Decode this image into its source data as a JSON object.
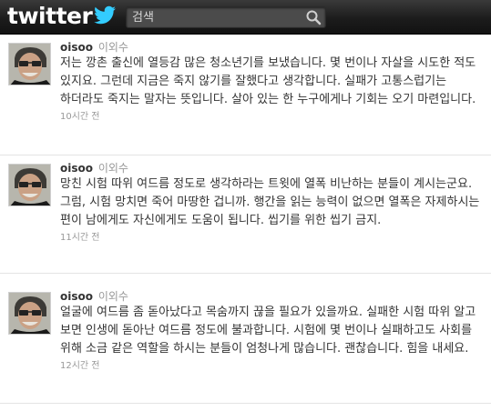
{
  "header": {
    "logo_text": "twitter",
    "search_placeholder": "검색",
    "search_icon": "magnifier-icon",
    "colors": {
      "bar": "#1c1c1c",
      "bird": "#33ccff"
    }
  },
  "tweets": [
    {
      "screen_name": "oisoo",
      "full_name": "이외수",
      "text": "저는 깡촌 출신에 열등감 많은 청소년기를 보냈습니다. 몇 번이나 자살을 시도한 적도 있지요. 그런데 지금은 죽지 않기를 잘했다고 생각합니다. 실패가 고통스럽기는 하더라도 죽지는 말자는 뜻입니다. 살아 있는 한 누구에게나 기회는 오기 마련입니다.",
      "time": "10시간 전"
    },
    {
      "screen_name": "oisoo",
      "full_name": "이외수",
      "text": "망친 시험 따위 여드름 정도로 생각하라는 트윗에 열폭 비난하는 분들이 계시는군요. 그럼, 시험 망치면 죽어 마땅한 겁니까. 행간을 읽는 능력이 없으면 열폭은 자제하시는 편이 남에게도 자신에게도 도움이 됩니다. 씹기를 위한 씹기 금지.",
      "time": "11시간 전"
    },
    {
      "screen_name": "oisoo",
      "full_name": "이외수",
      "text": "얼굴에 여드름 좀 돋아났다고 목숨까지 끊을 필요가 있을까요. 실패한 시험 따위 알고 보면 인생에 돋아난 여드름 정도에 불과합니다. 시험에 몇 번이나 실패하고도 사회를 위해 소금 같은 역할을 하시는 분들이 엄청나게 많습니다. 괜찮습니다. 힘을 내세요.",
      "time": "12시간 전"
    }
  ]
}
